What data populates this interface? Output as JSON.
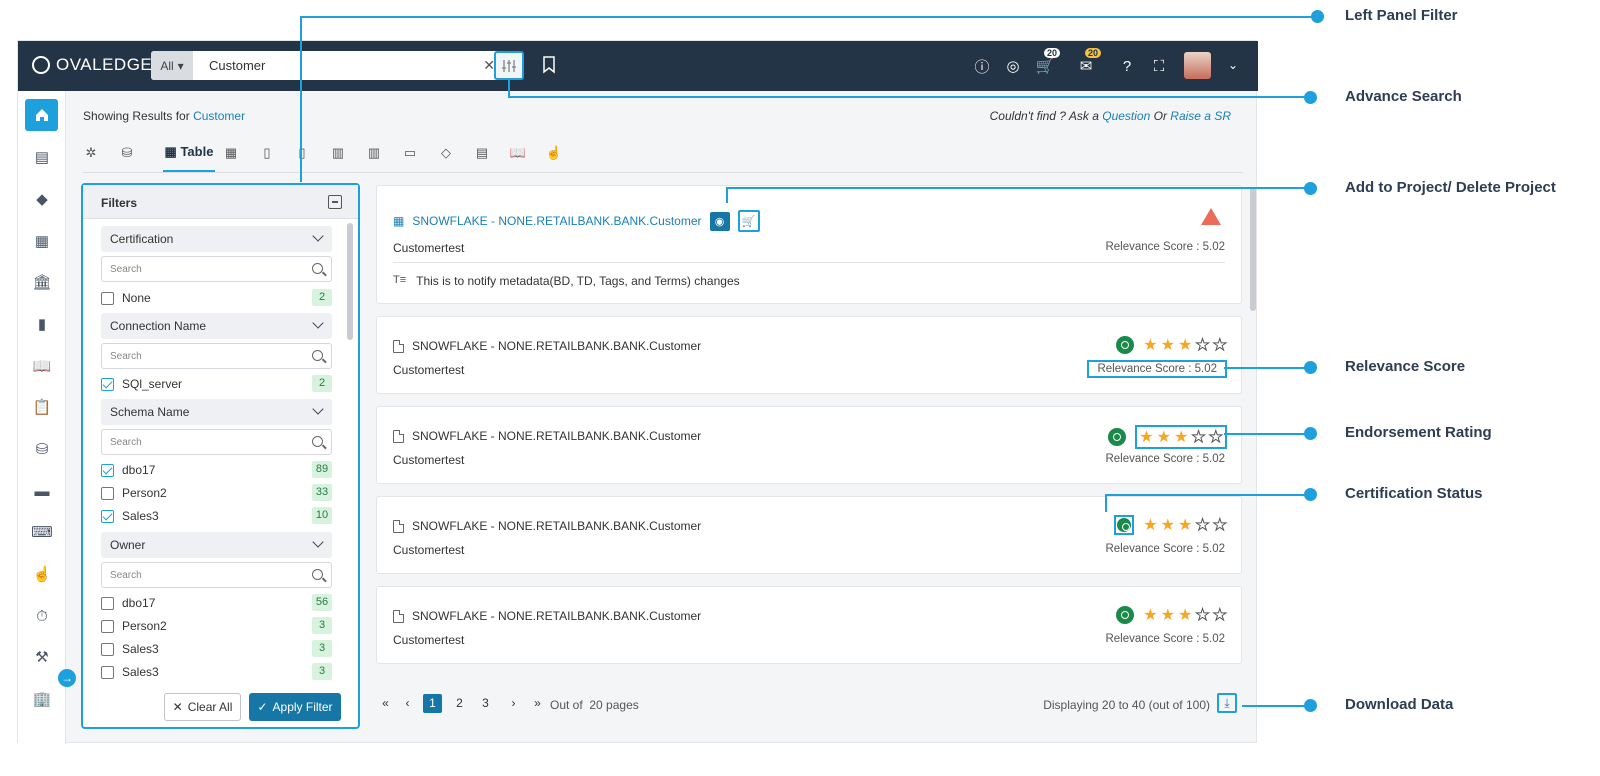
{
  "app": {
    "logo_text": "OVALEDGE"
  },
  "search": {
    "scope": "All",
    "query": "Customer"
  },
  "topbar": {
    "cart_count": "20",
    "mail_count": "20"
  },
  "sidebar": {
    "items": [
      "home-icon",
      "catalog-icon",
      "tag-icon",
      "report-icon",
      "bank-icon",
      "book-icon",
      "library-icon",
      "clipboard-icon",
      "database-check-icon",
      "folder-icon",
      "code-icon",
      "touch-icon",
      "timer-icon",
      "tools-icon",
      "building-icon"
    ]
  },
  "results_header": {
    "showing_prefix": "Showing  Results for",
    "keyword": "Customer",
    "help_text": "Couldn't find ? Ask a",
    "help_link1": "Question",
    "help_or": "Or",
    "help_link2": "Raise a SR"
  },
  "type_tabs": {
    "active_label": "Table"
  },
  "filters": {
    "title": "Filters",
    "search_placeholder": "Search",
    "sections": [
      {
        "label": "Certification",
        "options": [
          {
            "label": "None",
            "count": "2",
            "checked": false
          }
        ]
      },
      {
        "label": "Connection Name",
        "options": [
          {
            "label": "SQl_server",
            "count": "2",
            "checked": true
          }
        ]
      },
      {
        "label": "Schema Name",
        "options": [
          {
            "label": "dbo17",
            "count": "89",
            "checked": true
          },
          {
            "label": "Person2",
            "count": "33",
            "checked": false
          },
          {
            "label": "Sales3",
            "count": "10",
            "checked": true
          }
        ]
      },
      {
        "label": "Owner",
        "options": [
          {
            "label": "dbo17",
            "count": "56",
            "checked": false
          },
          {
            "label": "Person2",
            "count": "3",
            "checked": false
          },
          {
            "label": "Sales3",
            "count": "3",
            "checked": false
          },
          {
            "label": "Sales3",
            "count": "3",
            "checked": false
          }
        ]
      }
    ],
    "clear_label": "Clear All",
    "apply_label": "Apply Filter"
  },
  "results": [
    {
      "title": "SNOWFLAKE - NONE.RETAILBANK.BANK.Customer",
      "subtitle": "Customertest",
      "relevance": "Relevance Score : 5.02",
      "note": "This is to notify metadata(BD, TD, Tags, and Terms) changes",
      "rating": null
    },
    {
      "title": "SNOWFLAKE - NONE.RETAILBANK.BANK.Customer",
      "subtitle": "Customertest",
      "relevance": "Relevance Score : 5.02",
      "rating": 3
    },
    {
      "title": "SNOWFLAKE - NONE.RETAILBANK.BANK.Customer",
      "subtitle": "Customertest",
      "relevance": "Relevance Score : 5.02",
      "rating": 3
    },
    {
      "title": "SNOWFLAKE - NONE.RETAILBANK.BANK.Customer",
      "subtitle": "Customertest",
      "relevance": "Relevance Score : 5.02",
      "rating": 3
    },
    {
      "title": "SNOWFLAKE - NONE.RETAILBANK.BANK.Customer",
      "subtitle": "Customertest",
      "relevance": "Relevance Score : 5.02",
      "rating": 3
    }
  ],
  "pagination": {
    "pages": [
      "1",
      "2",
      "3"
    ],
    "current": "1",
    "out_of_text": "Out of",
    "total_pages_text": "20 pages",
    "display_text": "Displaying 20 to 40 (out of 100)"
  },
  "callouts": {
    "left_panel_filter": "Left Panel Filter",
    "advance_search": "Advance Search",
    "add_to_project": "Add to Project/ Delete Project",
    "relevance_score": "Relevance Score",
    "endorsement_rating": "Endorsement Rating",
    "certification_status": "Certification Status",
    "download_data": "Download Data"
  },
  "colors": {
    "accent": "#1ea0dc",
    "topbar": "#243447",
    "primary_button": "#1677a6",
    "star": "#f5a623",
    "certified": "#1a8a4a"
  }
}
